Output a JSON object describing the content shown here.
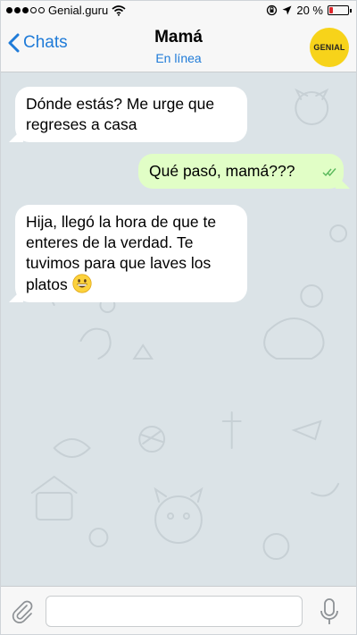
{
  "status_bar": {
    "carrier": "Genial.guru",
    "battery_percent_label": "20 %",
    "battery_level": 0.2,
    "signal_bars_filled": 3,
    "signal_bars_total": 5
  },
  "header": {
    "back_label": "Chats",
    "contact_name": "Mamá",
    "presence": "En línea",
    "avatar_label": "GENIAL"
  },
  "messages": [
    {
      "direction": "incoming",
      "text": "Dónde estás? Me urge que regreses a casa"
    },
    {
      "direction": "outgoing",
      "text": "Qué pasó, mamá???",
      "status": "read"
    },
    {
      "direction": "incoming",
      "text": "Hija, llegó la hora de que te enteres de la verdad. Te tuvimos para que laves los platos",
      "emoji": "grinning-face"
    }
  ],
  "composer": {
    "value": "",
    "placeholder": ""
  },
  "colors": {
    "accent": "#1f7bd8",
    "chat_background": "#dbe3e7",
    "incoming_bubble": "#ffffff",
    "outgoing_bubble": "#e1fec6",
    "avatar": "#f7d31a",
    "read_ticks": "#59b85b",
    "battery_low": "#e0262b"
  },
  "icons": [
    "back-chevron-icon",
    "wifi-icon",
    "location-arrow-icon",
    "orientation-lock-icon",
    "battery-icon",
    "paperclip-icon",
    "microphone-icon",
    "read-ticks-icon",
    "grinning-face-emoji"
  ]
}
